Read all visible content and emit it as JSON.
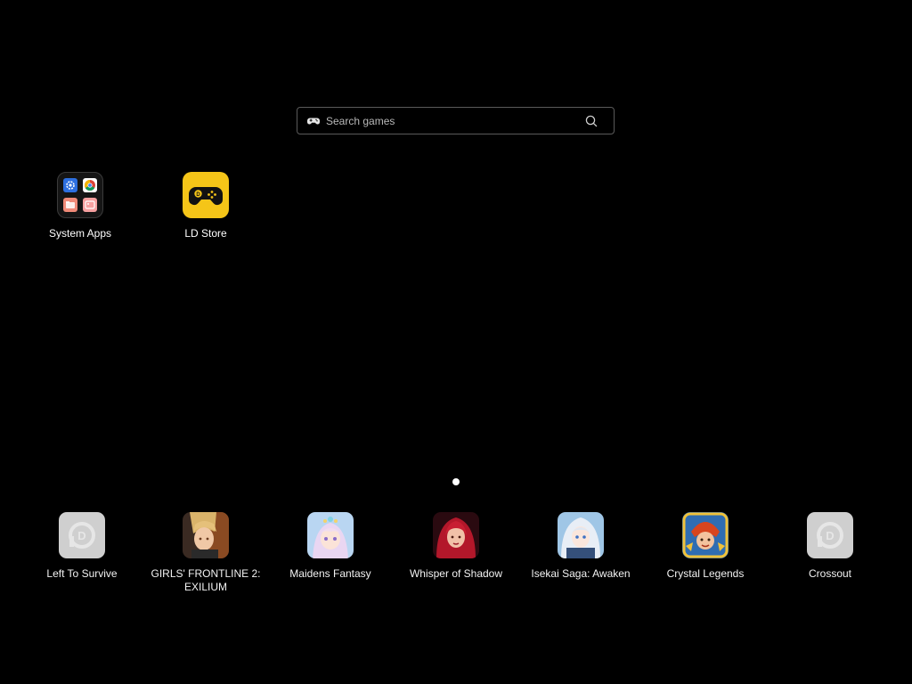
{
  "search": {
    "placeholder": "Search games"
  },
  "top_apps": [
    {
      "label": "System Apps",
      "icon": "folder-icon"
    },
    {
      "label": "LD Store",
      "icon": "gamepad-store-icon",
      "color": "#f5c518"
    }
  ],
  "pager": {
    "current_page": 1,
    "total_pages": 1
  },
  "dock_apps": [
    {
      "label": "Left To Survive",
      "icon": "placeholder-app-icon"
    },
    {
      "label": "GIRLS' FRONTLINE 2: EXILIUM",
      "icon": "girls-frontline-icon"
    },
    {
      "label": "Maidens Fantasy",
      "icon": "maidens-fantasy-icon"
    },
    {
      "label": "Whisper of Shadow",
      "icon": "whisper-of-shadow-icon"
    },
    {
      "label": "Isekai Saga: Awaken",
      "icon": "isekai-saga-icon"
    },
    {
      "label": "Crystal Legends",
      "icon": "crystal-legends-icon"
    },
    {
      "label": "Crossout",
      "icon": "placeholder-app-icon"
    }
  ],
  "colors": {
    "background": "#000000",
    "accent_yellow": "#f5c518",
    "placeholder_tile": "#cfcfcf"
  }
}
